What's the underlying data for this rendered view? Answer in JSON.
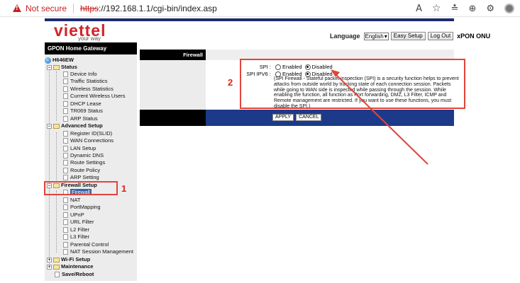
{
  "browser": {
    "security_label": "Not secure",
    "url_protocol": "https",
    "url_rest": "://192.168.1.1/cgi-bin/index.asp",
    "icons": [
      "read-aloud-icon",
      "star-icon",
      "favorites-icon",
      "collections-icon",
      "extensions-icon",
      "profile-icon"
    ]
  },
  "header": {
    "logo": "viettel",
    "tagline": "your way",
    "language_label": "Language",
    "language_value": "English",
    "easy_setup": "Easy Setup",
    "log_out": "Log Out",
    "product": "xPON ONU"
  },
  "sidebar": {
    "title": "GPON Home Gateway",
    "root": "H646EW",
    "status": {
      "label": "Status",
      "items": [
        "Device Info",
        "Traffic Statistics",
        "Wireless Statistics",
        "Current Wireless Users",
        "DHCP Lease",
        "TR069 Status",
        "ARP Status"
      ]
    },
    "advanced": {
      "label": "Advanced Setup",
      "items": [
        "Register ID(SLID)",
        "WAN Connections",
        "LAN Setup",
        "Dynamic DNS",
        "Route Settings",
        "Route Policy",
        "ARP Setting"
      ]
    },
    "firewall": {
      "label": "Firewall Setup",
      "items": [
        "Firewall",
        "NAT",
        "PortMapping",
        "UPnP",
        "URL Filter",
        "L2 Filter",
        "L3 Filter",
        "Parental Control",
        "NAT Session Management"
      ]
    },
    "wifi": "Wi-Fi Setup",
    "maintenance": "Maintenance",
    "save_reboot": "Save/Reboot"
  },
  "main": {
    "section_title": "Firewall",
    "spi_label": "SPI :",
    "spi_ipv6_label": "SPI IPV6 :",
    "enabled": "Enabled",
    "disabled": "Disabled",
    "spi_value": "Disabled",
    "spi_ipv6_value": "Disabled",
    "description": "(SPI Firewall - Stateful packet inspection (SPI) is a security function helps to prevent attacks from outside world by tracking state of each connection session. Packets while going to WAN side is inspected while passing through the session. While enabling the function, all function as Port forwarding, DMZ, L3 Filter, ICMP and Remote management are restricted. If you want to use these functions, you must disable the SPI.)",
    "apply": "APPLY",
    "cancel": "CANCEL"
  },
  "annotations": {
    "label1": "1",
    "label2": "2",
    "color": "#e0453b"
  }
}
